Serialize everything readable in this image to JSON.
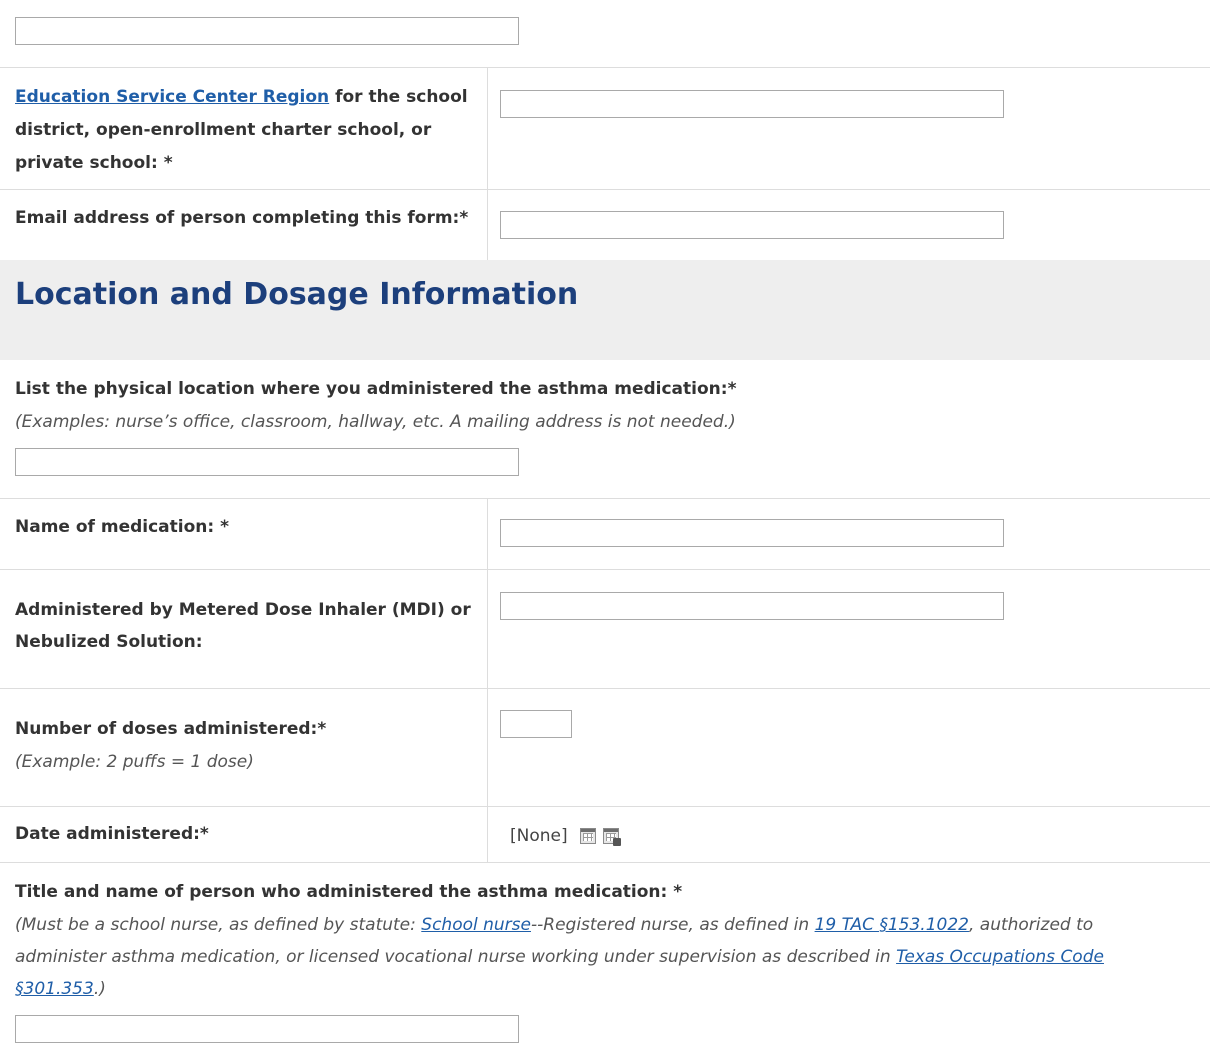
{
  "top_row": {
    "input_value": ""
  },
  "region_row": {
    "link_text": "Education Service Center Region",
    "label_line1_rest": " for the school",
    "label_line2": "district, open-enrollment charter school, or",
    "label_line3": "private school: *",
    "input_value": ""
  },
  "email_row": {
    "label": "Email address of person completing this form:*",
    "input_value": ""
  },
  "section": {
    "title": "Location and Dosage Information"
  },
  "location_row": {
    "label": "List the physical location where you administered the asthma medication:*",
    "hint": "(Examples: nurse’s office, classroom, hallway, etc. A mailing address is not needed.)",
    "input_value": ""
  },
  "medication_row": {
    "label": "Name of medication: *",
    "input_value": ""
  },
  "administered_by_row": {
    "label_line1": "Administered by Metered Dose Inhaler (MDI) or",
    "label_line2": "Nebulized Solution:",
    "input_value": ""
  },
  "doses_row": {
    "label": "Number of doses administered:*",
    "hint": "(Example: 2 puffs = 1 dose)",
    "input_value": ""
  },
  "date_row": {
    "label": "Date administered:*",
    "value": "[None]",
    "icons": [
      "calendar-icon",
      "calendar-clear-icon"
    ]
  },
  "nurse_row": {
    "label": "Title and name of person who administered the asthma medication: *",
    "hint_part1": "(Must be a school nurse, as defined by statute: ",
    "link_school_nurse": "School nurse",
    "hint_part2": "--Registered nurse, as defined in ",
    "link_tac": "19 TAC §153.1022",
    "hint_part3": ", authorized to",
    "hint_line2": "administer asthma medication, or licensed vocational nurse working under supervision as described in ",
    "link_occ_code_part1": "Texas Occupations Code",
    "link_occ_code_part2": "§301.353",
    "hint_end": ".)",
    "input_value": ""
  },
  "colors": {
    "section_title": "#1c3f7c",
    "link": "#1f5ea8",
    "section_bg": "#eeeeee",
    "border": "#dddddd"
  }
}
